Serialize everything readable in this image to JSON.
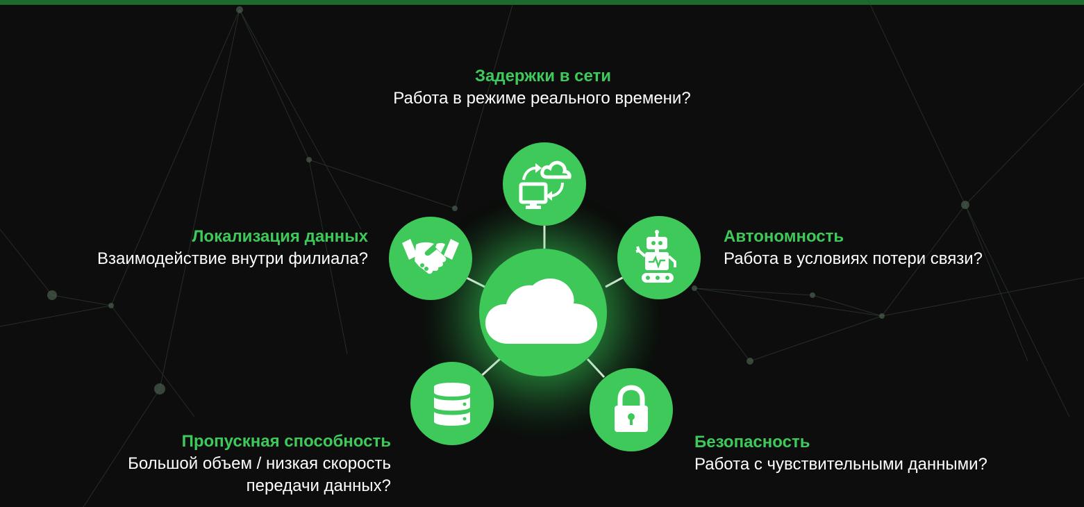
{
  "colors": {
    "accent": "#3ec95a",
    "background": "#0c0d0c",
    "text": "#ffffff",
    "top_bar": "#1d6a2e"
  },
  "center": {
    "icon": "cloud-icon"
  },
  "items": [
    {
      "id": "latency",
      "icon": "cloud-sync-monitor-icon",
      "title": "Задержки в сети",
      "text": "Работа в режиме реального времени?"
    },
    {
      "id": "locality",
      "icon": "handshake-icon",
      "title": "Локализация данных",
      "text": "Взаимодействие внутри филиала?"
    },
    {
      "id": "autonomy",
      "icon": "robot-icon",
      "title": "Автономность",
      "text": "Работа в условиях потери связи?"
    },
    {
      "id": "bandwidth",
      "icon": "database-icon",
      "title": "Пропускная способность",
      "text": "Большой объем / низкая скорость",
      "text2": "передачи данных?"
    },
    {
      "id": "security",
      "icon": "lock-icon",
      "title": "Безопасность",
      "text": "Работа с чувствительными данными?"
    }
  ]
}
